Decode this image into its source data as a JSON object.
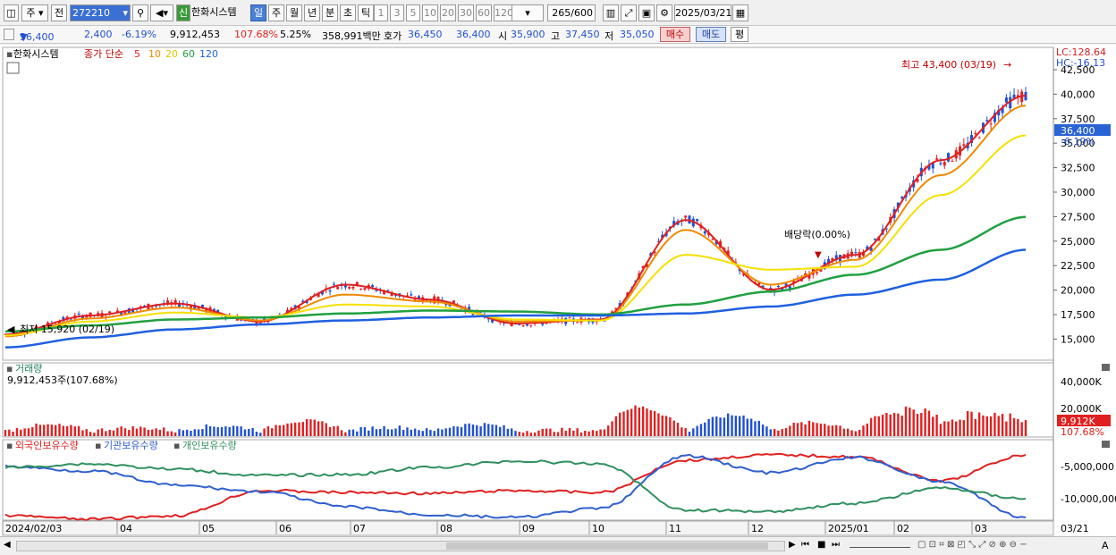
{
  "toolbar": {
    "market": "주",
    "prev": "전",
    "code": "272210",
    "name_badge": "신",
    "name": "한화시스템",
    "periods": [
      "일",
      "주",
      "월",
      "년",
      "분",
      "초",
      "틱"
    ],
    "active_period": "일",
    "intervals": [
      "1",
      "3",
      "5",
      "10",
      "20",
      "30",
      "60",
      "120"
    ],
    "count": "265",
    "count_max": "/600",
    "date": "2025/03/21"
  },
  "quote": {
    "price": "36,400",
    "arrow": "▼",
    "change": "2,400",
    "change_pct": "-6.19%",
    "volume": "9,912,453",
    "volume_ratio": "107.68%",
    "turnover_pct": "5.25%",
    "amount": "358,991백만",
    "ask_label": "호가",
    "ask": "36,450",
    "bid": "36,400",
    "open_label": "시",
    "open": "35,900",
    "high_label": "고",
    "high": "37,450",
    "low_label": "저",
    "low": "35,050",
    "buy": "매수",
    "sell": "매도",
    "eval": "평"
  },
  "price_panel": {
    "title": "한화시스템",
    "ma_label": "종가 단순",
    "ma_periods": [
      "5",
      "10",
      "20",
      "60",
      "120"
    ],
    "ma_colors": [
      "#e02020",
      "#f08a00",
      "#f5e000",
      "#20a040",
      "#2060e0"
    ],
    "lc": "LC:128.64",
    "hc": "HC:-16.13",
    "current": "36,400",
    "current_pct": "-6.19%",
    "high_note": "최고 43,400 (03/19)",
    "low_note": "최저 15,920 (02/19)",
    "dividend_note": "배당락(0.00%)",
    "y_ticks": [
      "42,500",
      "40,000",
      "37,500",
      "35,000",
      "32,500",
      "30,000",
      "27,500",
      "25,000",
      "22,500",
      "20,000",
      "17,500",
      "15,000"
    ]
  },
  "volume_panel": {
    "title": "거래량",
    "value": "9,912,453주(107.68%)",
    "y_ticks": [
      "40,000K",
      "20,000K"
    ],
    "current": "9,912K",
    "current_pct": "107.68%"
  },
  "holding_panel": {
    "legend": [
      "외국인보유수량",
      "기관보유수량",
      "개인보유수량"
    ],
    "legend_colors": [
      "#e02020",
      "#3060d0",
      "#309060"
    ],
    "y_ticks": [
      "-5,000,000",
      "-10,000,000"
    ]
  },
  "x_axis": {
    "labels": [
      "2024/02/03",
      "04",
      "05",
      "06",
      "07",
      "08",
      "09",
      "10",
      "11",
      "12",
      "2025/01",
      "02",
      "03"
    ],
    "right_label": "03/21"
  },
  "chart_data": {
    "type": "line",
    "title": "한화시스템",
    "x": [
      "2024/02",
      "2024/04",
      "2024/05",
      "2024/06",
      "2024/07",
      "2024/08",
      "2024/09",
      "2024/10",
      "2024/11",
      "2024/12",
      "2025/01",
      "2025/02",
      "2025/03"
    ],
    "series": [
      {
        "name": "5",
        "values": [
          16500,
          18400,
          19600,
          17800,
          21500,
          20000,
          17600,
          18000,
          28000,
          21000,
          24500,
          34000,
          40500
        ]
      },
      {
        "name": "10",
        "values": [
          16300,
          18100,
          19200,
          17900,
          20500,
          19800,
          17800,
          17900,
          27000,
          21500,
          24000,
          32500,
          39500
        ]
      },
      {
        "name": "20",
        "values": [
          16400,
          17800,
          18700,
          18200,
          19500,
          19300,
          18000,
          17900,
          24500,
          23000,
          23300,
          30500,
          36500
        ]
      },
      {
        "name": "60",
        "values": [
          16800,
          17400,
          18000,
          18200,
          18600,
          18900,
          18800,
          18500,
          19500,
          20800,
          22500,
          25000,
          28300
        ]
      },
      {
        "name": "120",
        "values": [
          15200,
          16200,
          17000,
          17500,
          17900,
          18200,
          18400,
          18400,
          18600,
          19300,
          20500,
          22000,
          25000
        ]
      }
    ],
    "ylim": [
      14000,
      44000
    ]
  }
}
